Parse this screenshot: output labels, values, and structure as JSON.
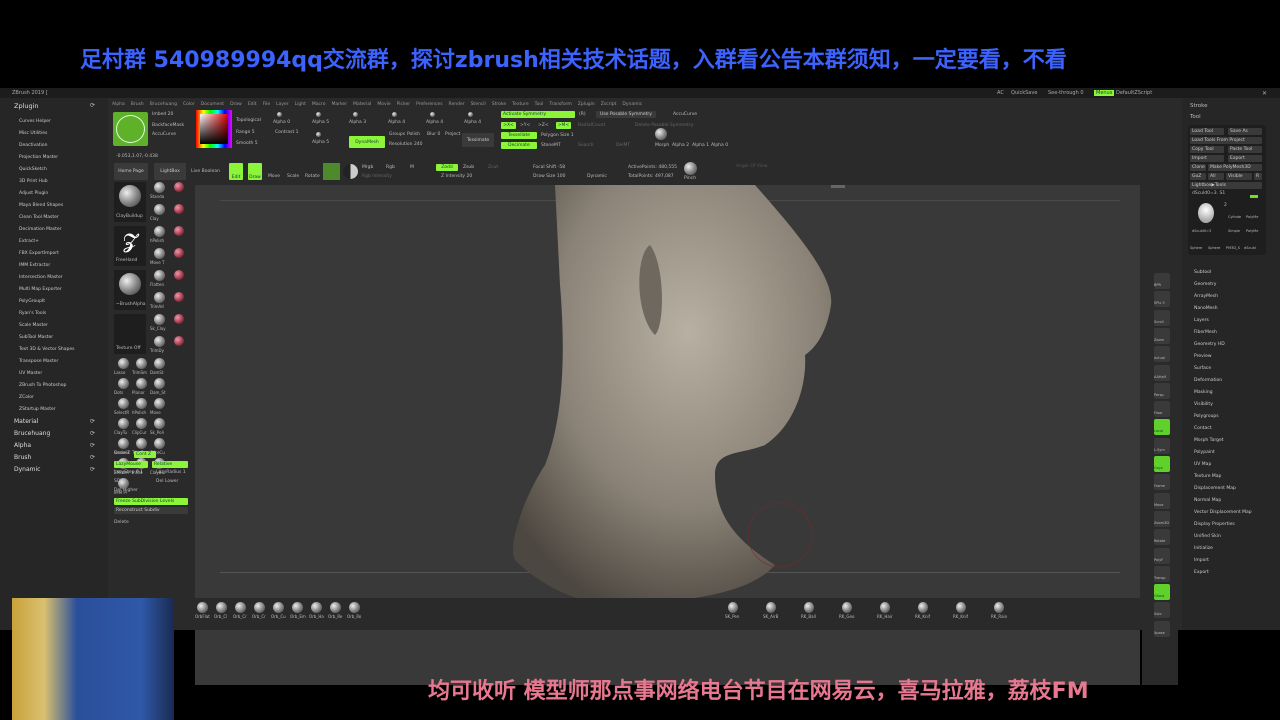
{
  "banner": "足村群  540989994qq交流群，探讨zbrush相关技术话题，入群看公告本群须知，一定要看，不看",
  "footer": "均可收听  模型师那点事网络电台节目在网易云，喜马拉雅，荔枝FM",
  "titlebar": {
    "title": "ZBrush 2019 [",
    "ac": "AC",
    "quicksave": "QuickSave",
    "seethrough": "See-through  0",
    "menus": "Menus",
    "script": "DefaultZScript"
  },
  "left": {
    "plugin_header": "Zplugin",
    "plugins": [
      "Curves Helper",
      "Misc Utilities",
      "Deactivation",
      "Projection Master",
      "QuickSketch",
      "3D Print Hub",
      "Adjust Plugin",
      "Maya Blend Shapes",
      "Clean Tool Master",
      "Decimation Master",
      "Extract+",
      "FBX ExportImport",
      "IMM Extractor",
      "Intersection Master",
      "Multi Map Exporter",
      "PolyGroupIt",
      "Ryan's Tools",
      "Scale Master",
      "SubTool Master",
      "Text 3D & Vector Shapes",
      "Transpose Master",
      "UV Master",
      "ZBrush To Photoshop",
      "ZColor",
      "ZStartup Master"
    ],
    "sections": [
      "Material",
      "Brucehuang",
      "Alpha",
      "Brush",
      "Dynamic"
    ]
  },
  "menubar": [
    "Alpha",
    "Brush",
    "Brucehuang",
    "Color",
    "Document",
    "Draw",
    "Edit",
    "File",
    "Layer",
    "Light",
    "Macro",
    "Marker",
    "Material",
    "Movie",
    "Picker",
    "Preferences",
    "Render",
    "Stencil",
    "Stroke",
    "Texture",
    "Tool",
    "Transform",
    "Zplugin",
    "Zscript",
    "Dynamic"
  ],
  "toolbar": {
    "imbed": "Imbed 20",
    "backface": "BackfaceMask",
    "accucurve": "AccuCurve",
    "topological": "Topological",
    "range": "Range 5",
    "smooth": "Smooth 5",
    "contrast": "Contrast 1",
    "alphas": [
      "Alpha 0",
      "Alpha 5",
      "Alpha 3",
      "Alpha 4",
      "Alpha 4",
      "Alpha 4",
      "Alpha 5"
    ],
    "dynamesh": "DynaMesh",
    "groups": "Groups",
    "polish": "Polish",
    "blur": "Blur 0",
    "project": "Project",
    "resolution": "Resolution 240",
    "tessimate": "Tessimate",
    "activate_symmetry": "Activate Symmetry",
    "r": "(R)",
    "use_posable": "Use Posable Symmetry",
    "accucurve2": "AccuCurve",
    "x": ">X<",
    "y": ">Y<",
    "z": ">Z<",
    "m": ">M<",
    "radial": "RadialCount",
    "delete_posable": "Delete Posable Symmetry",
    "tessellate": "Tessellate",
    "polygon_size": "Polygon Size 1",
    "decimate": "Decimate",
    "stonemt": "StoneMT",
    "search": "Search",
    "delmt": "DelMT",
    "morph": "Morph",
    "alpha2": "Alpha 2",
    "alpha1": "Alpha 1",
    "alpha0": "Alpha 0",
    "coords": "-0.053,1.07,-0.438",
    "home": "Home Page",
    "lightbox": "LightBox",
    "live_boolean": "Live Boolean",
    "edit": "Edit",
    "draw": "Draw",
    "move": "Move",
    "scale": "Scale",
    "rotate": "Rotate",
    "mrgb": "Mrgb",
    "rgb": "Rgb",
    "m_only": "M",
    "rgb_intensity": "Rgb Intensity",
    "zadd": "Zadd",
    "zsub": "Zsub",
    "zcut": "Zcut",
    "z_intensity": "Z Intensity 20",
    "focal": "Focal Shift -58",
    "draw_size": "Draw Size 100",
    "dynamic": "Dynamic",
    "active_points": "ActivePoints: 480,555",
    "total_points": "TotalPoints: 497,087",
    "pinch": "Pinch",
    "angle": "Angle Of View"
  },
  "toolpal": {
    "brush": "ClayBuildup",
    "stroke": "FreeHand",
    "alpha": "~BrushAlpha",
    "texture": "Texture Off",
    "small": [
      "Standa",
      "Clay",
      "hPolish",
      "Move T",
      "Flatten",
      "TrimAd",
      "Sk_Clay",
      "TrimDy",
      "Lasso",
      "TrimSm",
      "DamSt",
      "Dots",
      "Planar",
      "Dam_St",
      "SelectR",
      "hPolish",
      "Move",
      "ClayTu",
      "ClipCur",
      "Sk_Poli",
      "SnakeH",
      "TrimCu",
      "SliceCu",
      "ZModel",
      "Inflat",
      "ClayBu",
      "IMM Pr"
    ],
    "once_z": "Once Z",
    "cont_z": "Cont Z",
    "lazymouse": "LazyMouse",
    "relative": "Relative",
    "lazystep": "LazyStep 0.1",
    "lazyradius": "LazyRadius 1",
    "sdiv": "SDiv",
    "del_lower": "Del Lower",
    "del_higher": "Del Higher",
    "freeze": "Freeze SubDivision Levels",
    "reconstruct": "Reconstruct Subdiv",
    "delete": "Delete"
  },
  "right_shelf": [
    "BPR",
    "SPix 3",
    "Scroll",
    "Zoom",
    "Actual",
    "AAHalf",
    "Persp",
    "Floor",
    "Local",
    "L.Sym",
    "Gxyz",
    "Frame",
    "Move",
    "Zoom3D",
    "Rotate",
    "PolyF",
    "Transp",
    "Ghost",
    "Solo",
    "Xpose"
  ],
  "right": {
    "stroke": "Stroke",
    "tool": "Tool",
    "load_tool": "Load Tool",
    "save_as": "Save As",
    "load_project": "Load Tools From Project",
    "copy_tool": "Copy Tool",
    "paste_tool": "Paste Tool",
    "import": "Import",
    "export": "Export",
    "clone": "Clone",
    "make_polymesh": "Make PolyMesh3D",
    "goz": "GoZ",
    "all": "All",
    "visible": "Visible",
    "r": "R",
    "lightbox_tools": "Lightbox▶Tools",
    "current": "dSculd0=3. S1",
    "count": "2",
    "thumbs": [
      "dSculd0=3",
      "Cylinde",
      "PolyMe",
      "Simple",
      "PolyMe",
      "Sphere",
      "Sphere",
      "PM3D_S",
      "dSculd"
    ],
    "items": [
      "Subtool",
      "Geometry",
      "ArrayMesh",
      "NanoMesh",
      "Layers",
      "FiberMesh",
      "Geometry HD",
      "Preview",
      "Surface",
      "Deformation",
      "Masking",
      "Visibility",
      "Polygroups",
      "Contact",
      "Morph Target",
      "Polypaint",
      "UV Map",
      "Texture Map",
      "Displacement Map",
      "Normal Map",
      "Vector Displacement Map",
      "Display Properties",
      "Unified Skin",
      "Initialize",
      "Import",
      "Export"
    ]
  },
  "bottom": {
    "left": [
      "OrbFlat",
      "Orb_Cl",
      "Orb_Cr",
      "Orb_Cr",
      "Orb_Cu",
      "Orb_Em",
      "Orb_Ha",
      "Orb_Re",
      "Orb_Ro"
    ],
    "right": [
      "SK_Pen",
      "SK_AirB",
      "RK_Ball",
      "RK_Geo",
      "RK_Hair",
      "RK_Knif",
      "RK_Knif",
      "RK_Rain"
    ]
  },
  "colors": {
    "accent": "#8cf53a",
    "banner": "#3d63ff",
    "footer": "#e87890"
  }
}
